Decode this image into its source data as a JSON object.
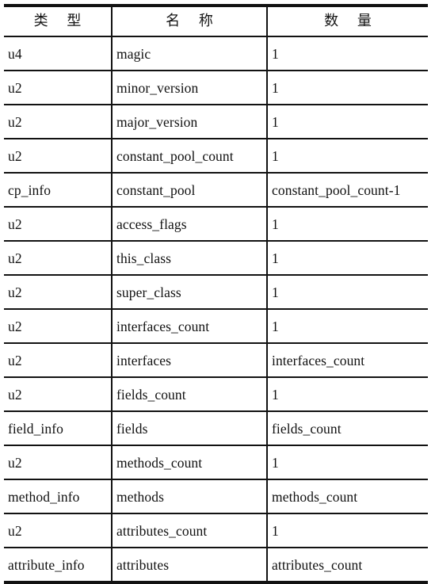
{
  "table": {
    "columns": [
      {
        "key": "type",
        "label": "类  型"
      },
      {
        "key": "name",
        "label": "名  称"
      },
      {
        "key": "count",
        "label": "数  量"
      }
    ],
    "rows": [
      {
        "type": "u4",
        "name": "magic",
        "count": "1"
      },
      {
        "type": "u2",
        "name": "minor_version",
        "count": "1"
      },
      {
        "type": "u2",
        "name": "major_version",
        "count": "1"
      },
      {
        "type": "u2",
        "name": "constant_pool_count",
        "count": "1"
      },
      {
        "type": "cp_info",
        "name": "constant_pool",
        "count": "constant_pool_count-1"
      },
      {
        "type": "u2",
        "name": "access_flags",
        "count": "1"
      },
      {
        "type": "u2",
        "name": "this_class",
        "count": "1"
      },
      {
        "type": "u2",
        "name": "super_class",
        "count": "1"
      },
      {
        "type": "u2",
        "name": "interfaces_count",
        "count": "1"
      },
      {
        "type": "u2",
        "name": "interfaces",
        "count": "interfaces_count"
      },
      {
        "type": "u2",
        "name": "fields_count",
        "count": "1"
      },
      {
        "type": "field_info",
        "name": "fields",
        "count": "fields_count"
      },
      {
        "type": "u2",
        "name": "methods_count",
        "count": "1"
      },
      {
        "type": "method_info",
        "name": "methods",
        "count": "methods_count"
      },
      {
        "type": "u2",
        "name": "attributes_count",
        "count": "1"
      },
      {
        "type": "attribute_info",
        "name": "attributes",
        "count": "attributes_count"
      }
    ]
  },
  "style": {
    "border_color": "#121212",
    "text_color": "#111111",
    "background": "#ffffff"
  }
}
